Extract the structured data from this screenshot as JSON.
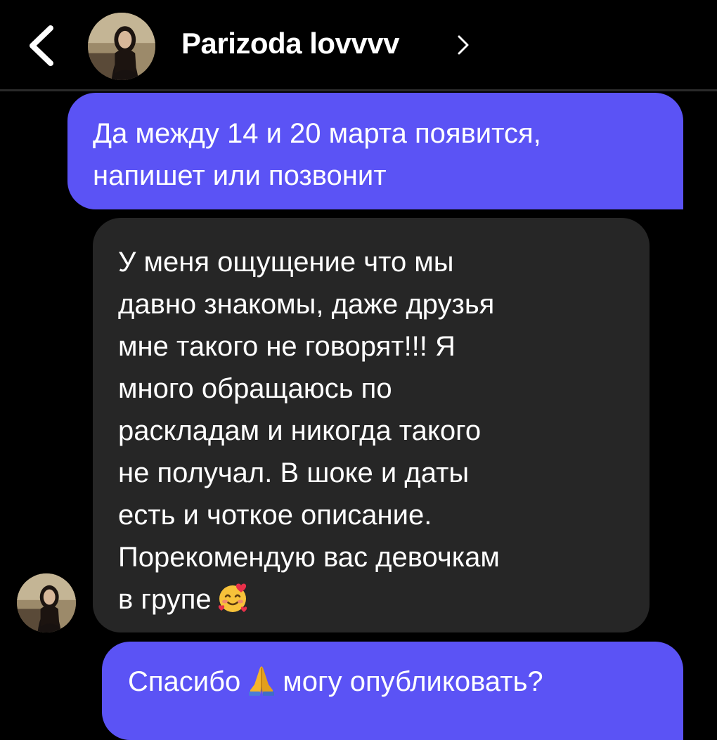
{
  "header": {
    "contact_name": "Parizoda lovvvv",
    "back_icon": "chevron-left-icon",
    "name_icon": "chevron-right-icon"
  },
  "messages": [
    {
      "direction": "outgoing",
      "lines": [
        "Да между 14 и 20 марта появится,",
        "напишет или позвонит"
      ]
    },
    {
      "direction": "incoming",
      "lines": [
        "У меня ощущение что мы",
        "давно знакомы, даже друзья",
        "мне такого не говорят!!! Я",
        "много обращаюсь по",
        "раскладам и никогда такого",
        "не получал. В шоке и даты",
        "есть и чоткое описание.",
        "Порекомендую вас девочкам",
        "в групе"
      ],
      "emoji": "smiling-face-with-hearts-icon"
    },
    {
      "direction": "outgoing",
      "text_before": "Спасибо",
      "emoji": "folded-hands-icon",
      "text_after": "могу опубликовать?"
    }
  ],
  "colors": {
    "background": "#000000",
    "outgoing_bubble": "#5b53f5",
    "incoming_bubble": "#262626",
    "text": "#ffffff"
  }
}
